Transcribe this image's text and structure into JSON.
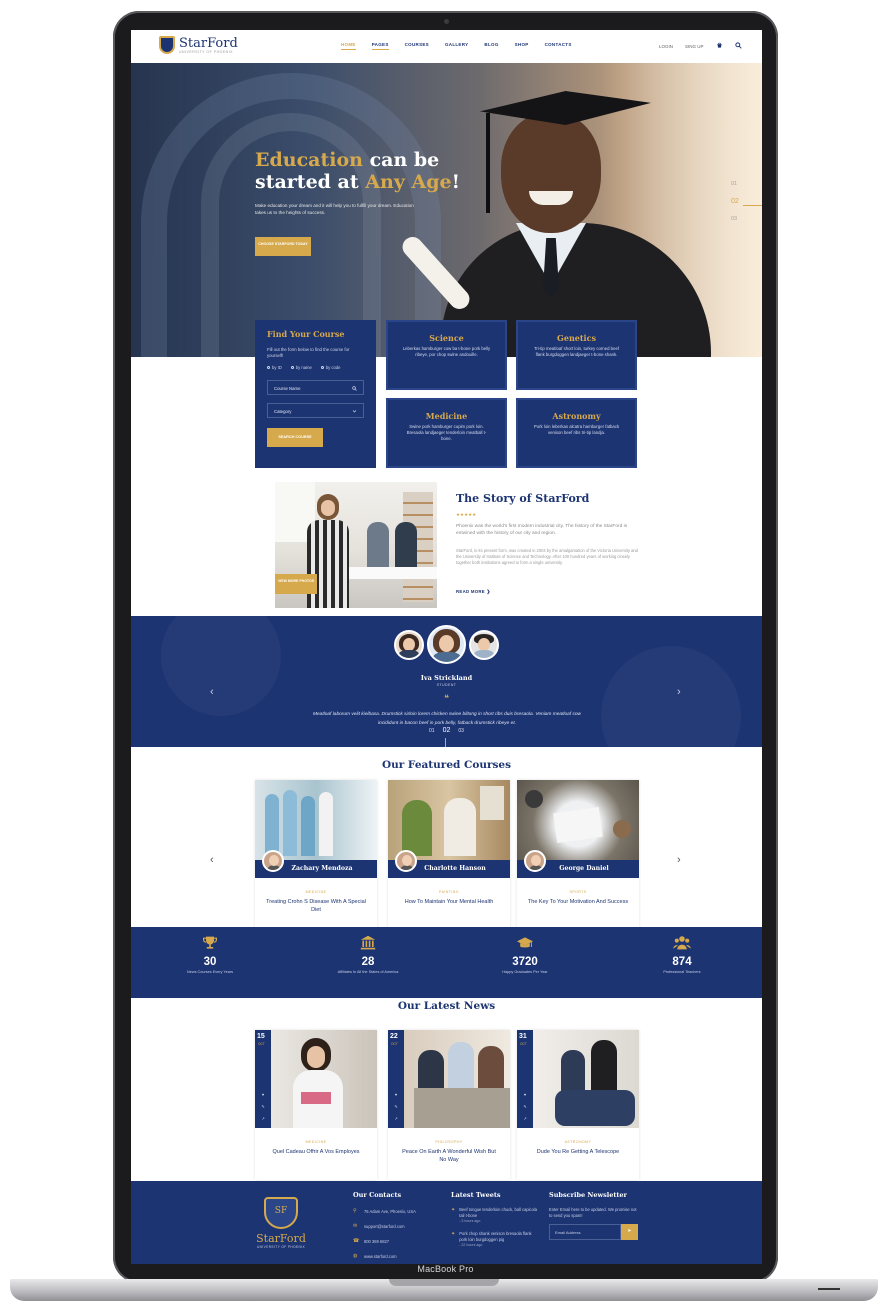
{
  "device": {
    "label": "MacBook Pro"
  },
  "header": {
    "logo": {
      "name_a": "Star",
      "name_b": "Ford",
      "subtitle": "UNIVERSITY OF PHOENIX"
    },
    "nav": [
      "HOME",
      "PAGES",
      "COURSES",
      "GALLERY",
      "BLOG",
      "SHOP",
      "CONTACTS"
    ],
    "login": "LOGIN",
    "signup": "SING UP",
    "cart_icon": "cart-icon",
    "search_icon": "search-icon"
  },
  "hero": {
    "title_a": "Education",
    "title_b": " can be",
    "title_c": "started at ",
    "title_d": "Any Age",
    "title_e": "!",
    "text": "Make education your dream and it will help you to fulfill your dream. Education takes us to the heights of success.",
    "button": "CHOOSE STARFORD TODAY",
    "slides": [
      "01",
      "02",
      "03"
    ]
  },
  "find": {
    "title_a": "Find ",
    "title_b": "Your Course",
    "description": "Fill out the form below to find the course for yourself!",
    "radios": [
      "by ID",
      "by name",
      "by code"
    ],
    "course_placeholder": "Course Name",
    "category_placeholder": "Category",
    "button": "SEARCH COURSE"
  },
  "cards": [
    {
      "title": "Science",
      "text": "Leberkas hamburger cow ba t-bone pork belly ribeye, por chop swine andouille."
    },
    {
      "title": "Genetics",
      "text": "Tri-tip meatloaf short loin, turkey corned beef flank burgdoggen landjaeger t-bone shank."
    },
    {
      "title": "Medicine",
      "text": "Swine pork hamburger cupim pork loin. Bresaola landjaeger tenderloin meatball t-bone."
    },
    {
      "title": "Astronomy",
      "text": "Pork loin leberkas alcatra hamburger fatback venison beef ribs tri-tip landja."
    }
  ],
  "story": {
    "title": "The Story of StarFord",
    "stars": "★★★★★",
    "lead": "Phoenix was the world's first modern industrial city. The history of the StarFord is entwined with the history of our city and region.",
    "body": "StarFord, in its present form, was created in 2004 by the amalgamation of the Victoria University and the University of Institute of Science and Technology. After 100 hundred years of working closely together both institutions agreed to form a single university.",
    "read_more": "READ MORE ❯",
    "image_button": "VIEW MORE PHOTOS"
  },
  "testimonial": {
    "name": "Iva Strickland",
    "role": "STUDENT",
    "quote_mark": "❝",
    "text": "Meatloaf laborum velit kielbasa. Drumstick sirloin lorem chicken swine biltong in short ribs duis bresaola. Veniam meatloaf cow incididunt in bacon beef in pork belly, fatback drumstick ribeye et.",
    "pager": [
      "01",
      "02",
      "03"
    ],
    "prev": "‹",
    "next": "›"
  },
  "featured": {
    "title": "Our Featured Courses",
    "prev": "‹",
    "next": "›",
    "courses": [
      {
        "teacher": "Zachary Mendoza",
        "category": "MEDICINE",
        "title": "Treating Crohn S Disease With A Special Diet"
      },
      {
        "teacher": "Charlotte Hanson",
        "category": "PAINTING",
        "title": "How To Maintain Your Mental Health"
      },
      {
        "teacher": "George Daniel",
        "category": "SPORTS",
        "title": "The Key To Your Motivation And Success"
      }
    ]
  },
  "stats": [
    {
      "icon": "trophy-icon",
      "value": "30",
      "label": "News Courses Every Years"
    },
    {
      "icon": "institution-icon",
      "value": "28",
      "label": "Affiliates In All the States of America"
    },
    {
      "icon": "graduation-cap-icon",
      "value": "3720",
      "label": "Happy Graduates Per Year"
    },
    {
      "icon": "users-icon",
      "value": "874",
      "label": "Professional Teachers"
    }
  ],
  "news": {
    "title": "Our Latest News",
    "items": [
      {
        "day": "15",
        "month": "OCT",
        "category": "MEDICINE",
        "title": "Quel Cadeau Offrir A Vos Employes"
      },
      {
        "day": "22",
        "month": "OCT",
        "category": "PHILOSOPHY",
        "title": "Peace On Earth A Wonderful Wish But No Way"
      },
      {
        "day": "31",
        "month": "OCT",
        "category": "ASTRONOMY",
        "title": "Dude You Re Getting A Telescope"
      }
    ]
  },
  "footer": {
    "logo_a": "Star",
    "logo_b": "Ford",
    "logo_sub": "UNIVERSITY OF PHOENIX",
    "contacts": {
      "title": "Our Contacts",
      "address": "76 Adam Ave, Phoenix, USA",
      "email": "support@starford.com",
      "phone": "800 369 6827",
      "website": "www.starford.com"
    },
    "tweets": {
      "title": "Latest Tweets",
      "items": [
        {
          "text": "Beef tongue tenderloin chuck, ball capicola tail t-bone",
          "time": "- 3 hours ago"
        },
        {
          "text": "Pork chop shank venison bresaola flank pork loin burgdoggen pig",
          "time": "- 22 hours ago"
        }
      ]
    },
    "newsletter": {
      "title": "Subscribe Newsletter",
      "text": "Enter Email here to be updated. We promise not to send you spam!",
      "placeholder": "Email Address",
      "button": "➤"
    }
  },
  "colors": {
    "navy": "#1d3473",
    "gold": "#d6a94c"
  }
}
